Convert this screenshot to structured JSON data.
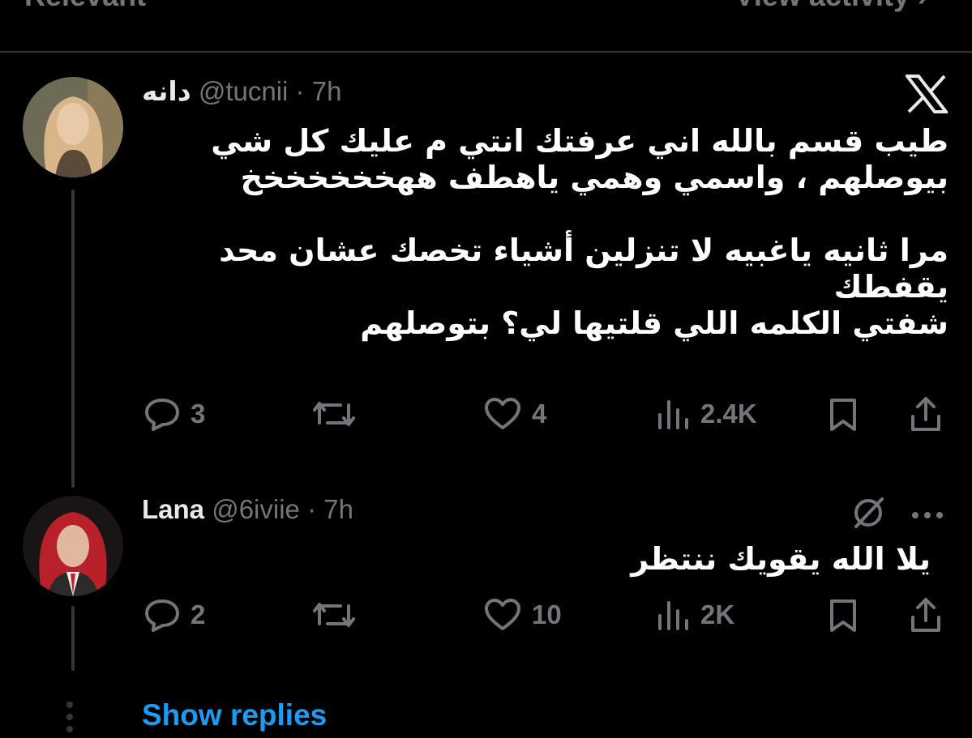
{
  "header": {
    "left_label": "Relevant",
    "right_label": "View activity ›"
  },
  "colors": {
    "background": "#000000",
    "text": "#e7e9ea",
    "muted": "#71767b",
    "link": "#1d9bf0",
    "divider": "#2f3336"
  },
  "tweets": [
    {
      "name": "دانه",
      "handle": "@tucnii",
      "separator": "·",
      "time": "7h",
      "badge_icon": "x-logo-icon",
      "text": "طيب قسم بالله اني عرفتك انتي م عليك كل شي\nبيوصلهم ، واسمي وهمي ياهطف ههخخخخخخخ\n\nمرا ثانيه ياغبيه لا تنزلين أشياء تخصك عشان محد\nيقفطك\nشفتي الكلمه اللي قلتيها لي؟ بتوصلهم",
      "actions": {
        "replies": "3",
        "retweets": "",
        "likes": "4",
        "views": "2.4K"
      }
    },
    {
      "name": "Lana",
      "handle": "@6iviie",
      "separator": "·",
      "time": "7h",
      "badge_icon": "grok-icon",
      "more_icon": "more-dots-icon",
      "text": "يلا الله يقويك ننتظر",
      "actions": {
        "replies": "2",
        "retweets": "",
        "likes": "10",
        "views": "2K"
      }
    }
  ],
  "show_replies_label": "Show replies"
}
